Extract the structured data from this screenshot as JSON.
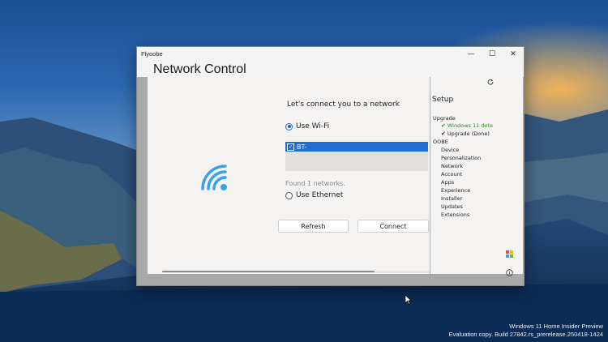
{
  "window": {
    "title": "Flyoobe",
    "app_title": "Network Control",
    "controls": {
      "minimize": "—",
      "maximize": "☐",
      "close": "✕"
    }
  },
  "main": {
    "heading": "Let's connect you to a network",
    "wifi_option": "Use Wi-Fi",
    "network_name": "BT-",
    "found_text": "Found 1 networks.",
    "ethernet_option": "Use Ethernet",
    "refresh_label": "Refresh",
    "connect_label": "Connect"
  },
  "sidebar": {
    "title": "Setup",
    "upgrade": "Upgrade",
    "upgrade_items": [
      "Windows 11 dete",
      "Upgrade (Done)"
    ],
    "oobe": "OOBE",
    "oobe_items": [
      "Device",
      "Personalization",
      "Network",
      "Account",
      "Apps",
      "Experience",
      "Installer",
      "Updates",
      "Extensions"
    ]
  },
  "desktop": {
    "edition": "Windows 11 Home Insider Preview",
    "build": "Evaluation copy. Build 27842.rs_prerelease.250418-1424"
  },
  "icons": [
    "wifi-icon",
    "refresh-icon",
    "panel-toggle-icon",
    "info-icon",
    "palette-icon",
    "checkmark-icon",
    "mouse-cursor-icon"
  ],
  "colors": {
    "accent": "#1f6dd6",
    "success": "#2e8b2e"
  }
}
